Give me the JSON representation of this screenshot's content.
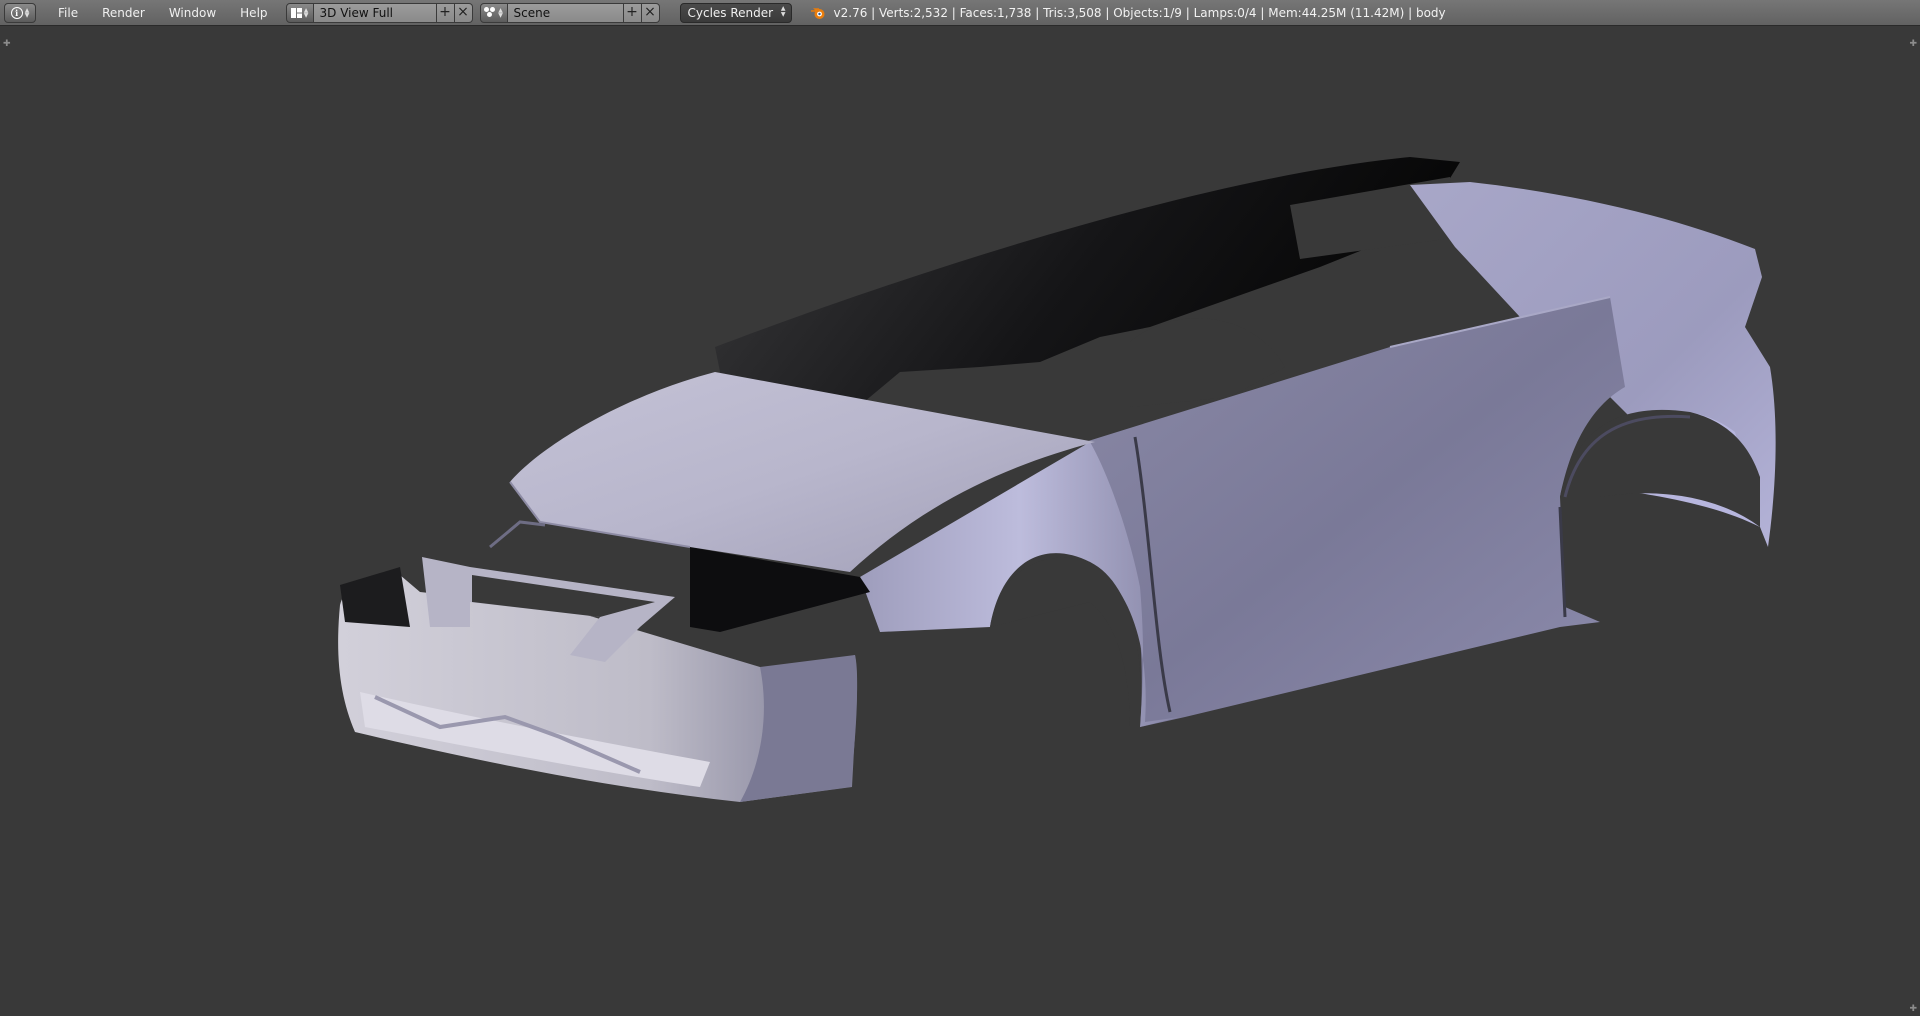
{
  "header": {
    "editor_type_icon": "info-icon",
    "menu": [
      "File",
      "Render",
      "Window",
      "Help"
    ],
    "screen_layout": {
      "icon": "screen-layout-icon",
      "value": "3D View Full"
    },
    "scene": {
      "icon": "scene-icon",
      "value": "Scene"
    },
    "render_engine": "Cycles Render",
    "logo": "blender-logo",
    "stats": "v2.76 | Verts:2,532 | Faces:1,738 | Tris:3,508 | Objects:1/9 | Lamps:0/4 | Mem:44.25M (11.42M) | body"
  },
  "viewport": {
    "background": "#393939",
    "object": "car-body-mesh"
  }
}
